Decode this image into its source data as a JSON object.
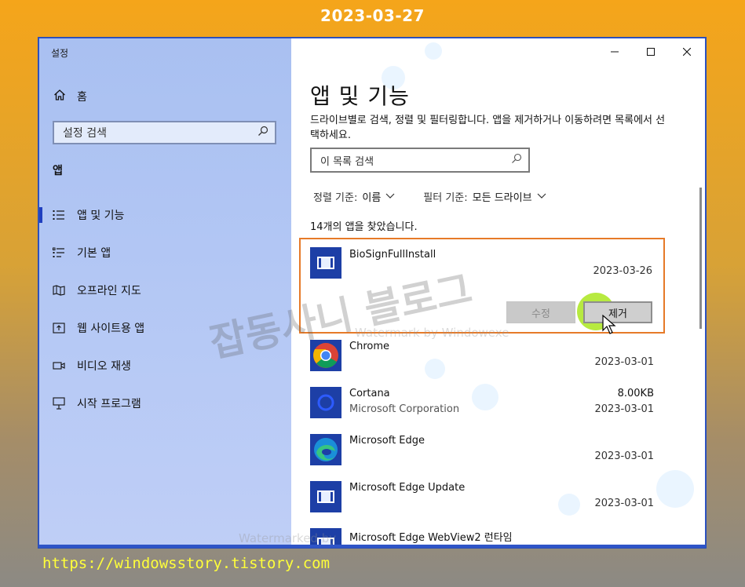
{
  "header_date": "2023-03-27",
  "footer_url": "https://windowsstory.tistory.com",
  "window": {
    "title": "설정"
  },
  "sidebar": {
    "home_label": "홈",
    "search_placeholder": "설정 검색",
    "section_label": "앱",
    "items": [
      {
        "label": "앱 및 기능",
        "icon": "apps-list-icon",
        "active": true
      },
      {
        "label": "기본 앱",
        "icon": "default-apps-icon",
        "active": false
      },
      {
        "label": "오프라인 지도",
        "icon": "map-icon",
        "active": false
      },
      {
        "label": "웹 사이트용 앱",
        "icon": "website-app-icon",
        "active": false
      },
      {
        "label": "비디오 재생",
        "icon": "video-icon",
        "active": false
      },
      {
        "label": "시작 프로그램",
        "icon": "startup-icon",
        "active": false
      }
    ]
  },
  "content": {
    "title": "앱 및 기능",
    "description": "드라이브별로 검색, 정렬 및 필터링합니다. 앱을 제거하거나 이동하려면 목록에서 선택하세요.",
    "search_placeholder": "이 목록 검색",
    "sort_label": "정렬 기준:",
    "sort_value": "이름",
    "filter_label": "필터 기준:",
    "filter_value": "모든 드라이브",
    "count_text": "14개의 앱을 찾았습니다.",
    "selected_app": {
      "name": "BioSignFullInstall",
      "date": "2023-03-26",
      "modify_button": "수정",
      "remove_button": "제거"
    },
    "apps": [
      {
        "name": "Chrome",
        "publisher": "",
        "size": "",
        "date": "2023-03-01",
        "icon": "chrome-icon"
      },
      {
        "name": "Cortana",
        "publisher": "Microsoft Corporation",
        "size": "8.00KB",
        "date": "2023-03-01",
        "icon": "cortana-icon"
      },
      {
        "name": "Microsoft Edge",
        "publisher": "",
        "size": "",
        "date": "2023-03-01",
        "icon": "edge-icon"
      },
      {
        "name": "Microsoft Edge Update",
        "publisher": "",
        "size": "",
        "date": "2023-03-01",
        "icon": "installer-icon"
      },
      {
        "name": "Microsoft Edge WebView2 런타임",
        "publisher": "",
        "size": "",
        "date": "",
        "icon": "installer-icon"
      }
    ]
  },
  "watermarks": {
    "main": "잡동사니 블로그",
    "small1": "Watermark by Windowexe",
    "small2": "Watermarked by"
  },
  "colors": {
    "accent": "#1f3fbf",
    "selection_border": "#e67a28",
    "footer_text": "#ffff3a"
  }
}
